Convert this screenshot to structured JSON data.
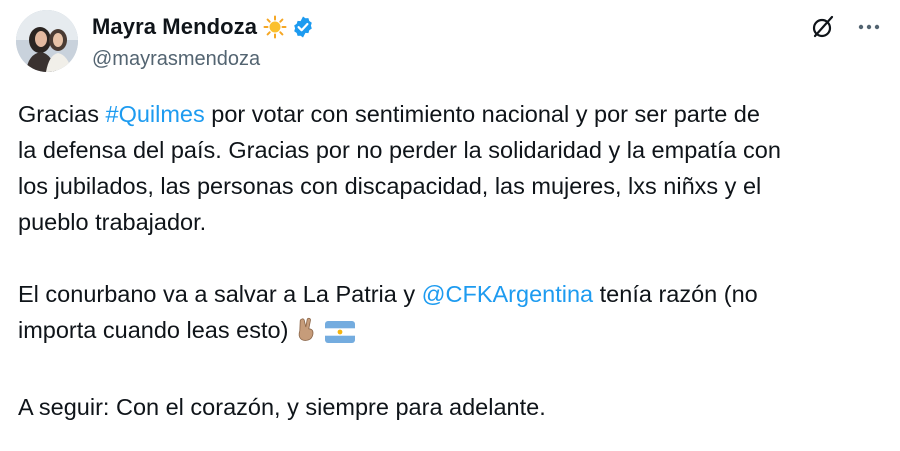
{
  "author": {
    "display_name": "Mayra Mendoza",
    "handle": "@mayrasmendoza",
    "name_emoji_icon": "sun-icon",
    "badge_icon": "verified-icon"
  },
  "actions": {
    "grok_icon": "grok-icon",
    "more_icon": "more-options-icon"
  },
  "tweet": {
    "p1": {
      "before": "Gracias ",
      "hashtag": "#Quilmes",
      "after_1": " por votar con sentimiento nacional y por ser parte de",
      "line2": "la defensa del país. Gracias por no perder la solidaridad y la empatía con",
      "line3": "los jubilados, las personas con discapacidad, las mujeres, lxs niñxs y el",
      "line4": "pueblo trabajador."
    },
    "p2": {
      "before": "El conurbano va a salvar a La Patria y ",
      "mention": "@CFKArgentina",
      "after": " tenía razón (no",
      "line2": "importa cuando leas esto)"
    },
    "p3": "A seguir: Con el corazón, y siempre para adelante."
  },
  "colors": {
    "link": "#1d9bf0",
    "text": "#0f1419",
    "secondary": "#536471",
    "verified": "#1d9bf0"
  }
}
